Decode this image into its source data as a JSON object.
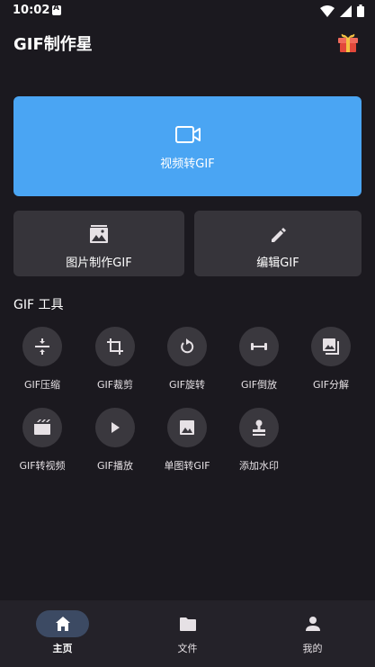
{
  "status_bar": {
    "time": "10:02"
  },
  "header": {
    "title": "GIF制作星"
  },
  "video_card": {
    "label": "视频转GIF",
    "color": "#4aa5f3"
  },
  "image_card": {
    "label": "图片制作GIF"
  },
  "edit_card": {
    "label": "编辑GIF"
  },
  "tools_section": {
    "title": "GIF 工具",
    "items": [
      {
        "label": "GIF压缩",
        "icon": "compress-icon"
      },
      {
        "label": "GIF裁剪",
        "icon": "crop-icon"
      },
      {
        "label": "GIF旋转",
        "icon": "rotate-icon"
      },
      {
        "label": "GIF倒放",
        "icon": "reverse-icon"
      },
      {
        "label": "GIF分解",
        "icon": "split-frames-icon"
      },
      {
        "label": "GIF转视频",
        "icon": "movie-icon"
      },
      {
        "label": "GIF播放",
        "icon": "play-icon"
      },
      {
        "label": "单图转GIF",
        "icon": "image-icon"
      },
      {
        "label": "添加水印",
        "icon": "stamp-icon"
      }
    ]
  },
  "bottom_nav": {
    "items": [
      {
        "label": "主页",
        "icon": "home-icon",
        "active": true
      },
      {
        "label": "文件",
        "icon": "folder-icon",
        "active": false
      },
      {
        "label": "我的",
        "icon": "person-icon",
        "active": false
      }
    ]
  },
  "colors": {
    "background": "#1b191f",
    "card": "#36343a",
    "accent": "#4aa5f3",
    "nav_pill": "#3c4a63"
  }
}
